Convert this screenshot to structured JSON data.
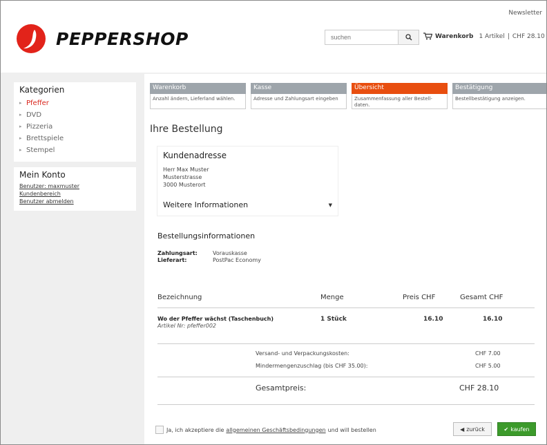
{
  "header": {
    "newsletter": "Newsletter",
    "brand": "PEPPERSHOP",
    "search": {
      "placeholder": "suchen"
    },
    "cart": {
      "label": "Warenkorb",
      "items": "1 Artikel",
      "separator": "|",
      "total": "CHF 28.10"
    }
  },
  "sidebar": {
    "categories_title": "Kategorien",
    "categories": [
      {
        "label": "Pfeffer",
        "active": true
      },
      {
        "label": "DVD"
      },
      {
        "label": "Pizzeria"
      },
      {
        "label": "Brettspiele"
      },
      {
        "label": "Stempel"
      }
    ],
    "account_title": "Mein Konto",
    "account_links": [
      "Benutzer: maxmuster",
      "Kundenbereich",
      "Benutzer abmelden"
    ]
  },
  "steps": [
    {
      "title": "Warenkorb",
      "desc": "Anzahl ändern, Lieferland wählen."
    },
    {
      "title": "Kasse",
      "desc": "Adresse und Zahlungsart eingeben"
    },
    {
      "title": "Übersicht",
      "desc": "Zusammenfassung aller Bestell-daten."
    },
    {
      "title": "Bestätigung",
      "desc": "Bestellbestätigung anzeigen."
    }
  ],
  "page_title": "Ihre Bestellung",
  "address": {
    "title": "Kundenadresse",
    "lines": [
      "Herr Max Muster",
      "Musterstrasse",
      "3000 Musterort"
    ],
    "more": "Weitere Informationen"
  },
  "order_info": {
    "title": "Bestellungsinformationen",
    "payment_label": "Zahlungsart:",
    "payment_value": "Vorauskasse",
    "delivery_label": "Lieferart:",
    "delivery_value": "PostPac Economy"
  },
  "table": {
    "headers": {
      "name": "Bezeichnung",
      "qty": "Menge",
      "price": "Preis CHF",
      "total": "Gesamt CHF"
    },
    "item": {
      "name": "Wo der Pfeffer wächst (Taschenbuch)",
      "article": "Artikel Nr: pfeffer002",
      "qty": "1 Stück",
      "price": "16.10",
      "total": "16.10"
    },
    "fees": [
      {
        "label": "Versand- und Verpackungskosten:",
        "value": "CHF 7.00"
      },
      {
        "label": "Mindermengenzuschlag (bis CHF 35.00):",
        "value": "CHF 5.00"
      }
    ],
    "total_label": "Gesamtpreis:",
    "total_value": "CHF 28.10"
  },
  "agree": {
    "prefix": "Ja, ich akzeptiere die",
    "link": "allgemeinen Geschäftsbedingungen",
    "suffix": "und will bestellen"
  },
  "buttons": {
    "back": "zurück",
    "buy": "kaufen"
  },
  "colors": {
    "accent": "#e84e0f",
    "brand_red": "#d9251c",
    "buy_green": "#3c9a2b"
  }
}
